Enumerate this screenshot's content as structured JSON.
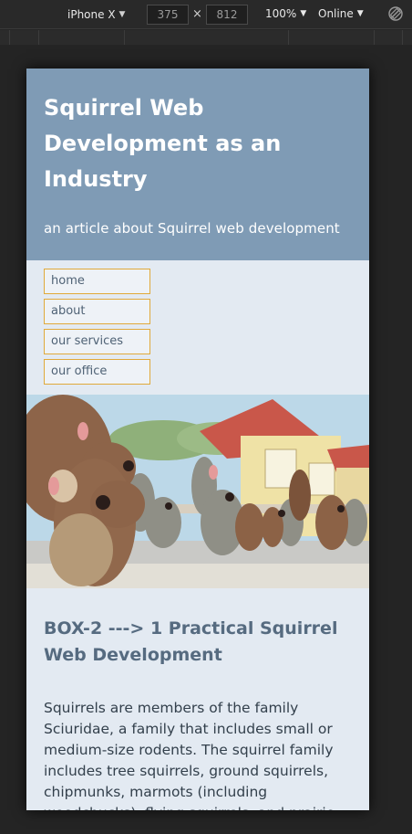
{
  "devtools": {
    "device": "iPhone X",
    "width": "375",
    "height": "812",
    "dimension_separator": "×",
    "zoom": "100%",
    "throttle": "Online",
    "icons": [
      "caret-down-icon",
      "rotate-icon"
    ]
  },
  "site": {
    "title": "Squirrel Web Development as an Industry",
    "subtitle": "an article about Squirrel web development",
    "nav": [
      "home",
      "about",
      "our services",
      "our office"
    ],
    "hero_alt": "cartoon squirrels crowd on street",
    "box": {
      "title": "BOX-2 ---> 1 Practical Squirrel Web Development",
      "text": "Squirrels are members of the family Sciuridae, a family that includes small or medium-size rodents. The squirrel family includes tree squirrels, ground squirrels, chipmunks, marmots (including woodchucks), flying squirrels, and prairie dogs."
    }
  },
  "colors": {
    "header_bg": "#7f9bb5",
    "page_bg": "#e3eaf2",
    "nav_border": "#e0a93a",
    "heading": "#566b80"
  }
}
